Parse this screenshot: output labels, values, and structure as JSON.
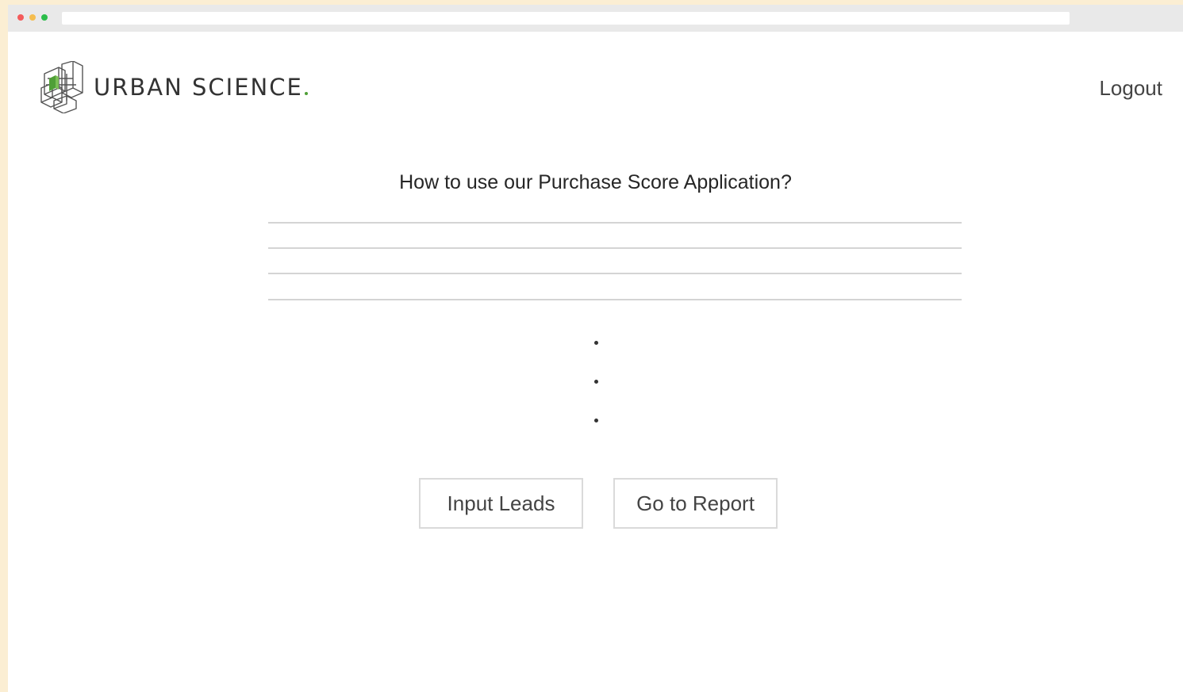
{
  "browser": {
    "colors": {
      "close": "#f45b5b",
      "minimize": "#f5bd4f",
      "maximize": "#2bbd4a"
    }
  },
  "header": {
    "brand_name": "URBAN SCIENCE",
    "logout_label": "Logout",
    "logo_icon": "urban-science-logo-icon",
    "accent_color": "#4f9f37"
  },
  "main": {
    "heading": "How to use our Purchase Score Application?",
    "buttons": {
      "input_leads": "Input Leads",
      "go_to_report": "Go to Report"
    }
  }
}
